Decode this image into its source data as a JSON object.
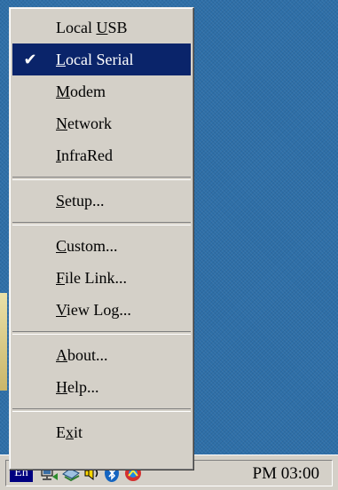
{
  "menu": {
    "items": [
      {
        "pre": "Local ",
        "mn": "U",
        "post": "SB",
        "checked": false,
        "selected": false
      },
      {
        "pre": "",
        "mn": "L",
        "post": "ocal Serial",
        "checked": true,
        "selected": true
      },
      {
        "pre": "",
        "mn": "M",
        "post": "odem",
        "checked": false,
        "selected": false
      },
      {
        "pre": "",
        "mn": "N",
        "post": "etwork",
        "checked": false,
        "selected": false
      },
      {
        "pre": "",
        "mn": "I",
        "post": "nfraRed",
        "checked": false,
        "selected": false
      },
      {
        "pre": "",
        "mn": "S",
        "post": "etup...",
        "checked": false,
        "selected": false
      },
      {
        "pre": "",
        "mn": "C",
        "post": "ustom...",
        "checked": false,
        "selected": false
      },
      {
        "pre": "",
        "mn": "F",
        "post": "ile Link...",
        "checked": false,
        "selected": false
      },
      {
        "pre": "",
        "mn": "V",
        "post": "iew Log...",
        "checked": false,
        "selected": false
      },
      {
        "pre": "",
        "mn": "A",
        "post": "bout...",
        "checked": false,
        "selected": false
      },
      {
        "pre": "",
        "mn": "H",
        "post": "elp...",
        "checked": false,
        "selected": false
      },
      {
        "pre": "E",
        "mn": "x",
        "post": "it",
        "checked": false,
        "selected": false
      }
    ],
    "check_glyph": "✔"
  },
  "taskbar": {
    "language_indicator": "En",
    "clock": "PM 03:00",
    "tray_icons": [
      "network-icon",
      "sync-icon",
      "volume-icon",
      "bluetooth-icon",
      "app-icon"
    ]
  },
  "colors": {
    "desktop": "#2e6fa8",
    "menu_bg": "#d4d0c8",
    "highlight": "#0a246a",
    "highlight_text": "#ffffff"
  }
}
